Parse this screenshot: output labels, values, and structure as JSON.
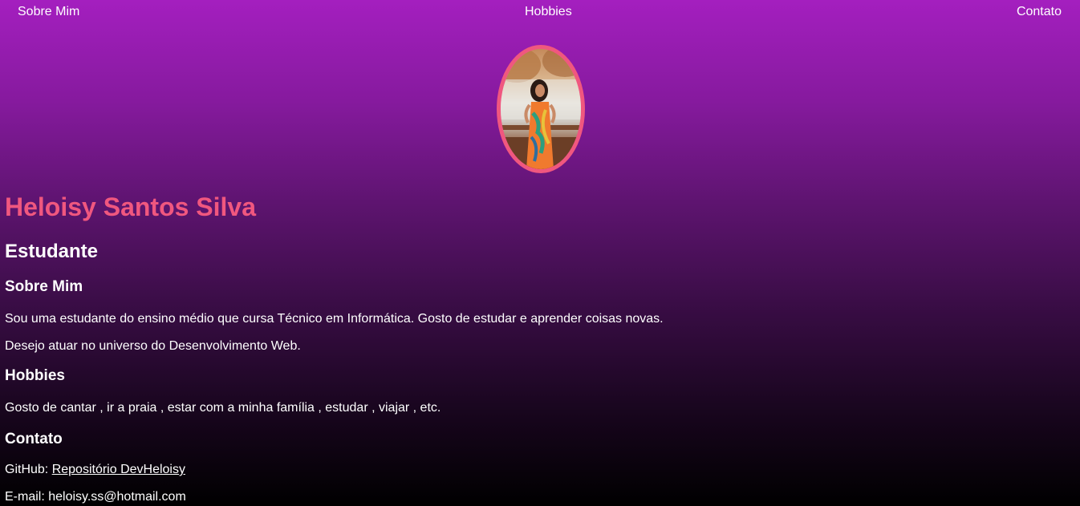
{
  "nav": {
    "items": [
      {
        "label": "Sobre Mim"
      },
      {
        "label": "Hobbies"
      },
      {
        "label": "Contato"
      }
    ]
  },
  "profile": {
    "name": "Heloisy Santos Silva",
    "role": "Estudante"
  },
  "about": {
    "title": "Sobre Mim",
    "paragraph1": "Sou uma estudante do ensino médio que cursa Técnico em Informática. Gosto de estudar e aprender coisas novas.",
    "paragraph2": "Desejo atuar no universo do Desenvolvimento Web."
  },
  "hobbies": {
    "title": "Hobbies",
    "text": "Gosto de cantar , ir a praia , estar com a minha família , estudar , viajar , etc."
  },
  "contact": {
    "title": "Contato",
    "github_label": "GitHub: ",
    "github_link": "Repositório DevHeloisy",
    "email": "E-mail: heloisy.ss@hotmail.com"
  },
  "colors": {
    "accent": "#f0577f",
    "gradient_top": "#a41fbf",
    "gradient_bottom": "#000000"
  }
}
